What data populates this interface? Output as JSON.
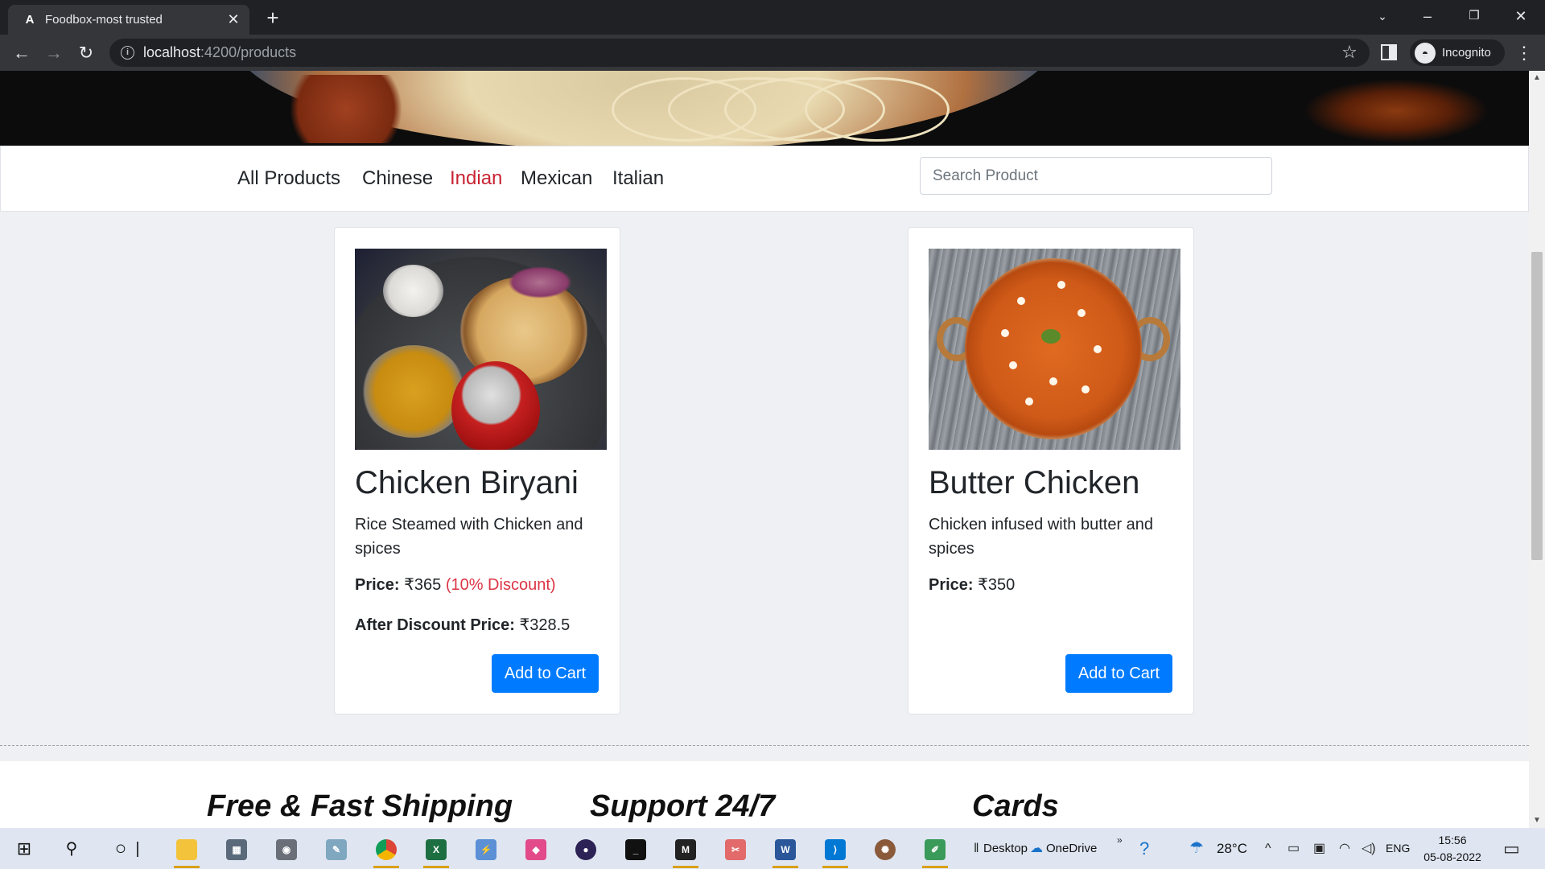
{
  "browser": {
    "tab_title": "Foodbox-most trusted",
    "tab_favicon": "A",
    "url_host": "localhost",
    "url_path": ":4200/products",
    "profile_label": "Incognito"
  },
  "category_nav": {
    "items": [
      {
        "label": "All Products",
        "active": false
      },
      {
        "label": "Chinese",
        "active": false
      },
      {
        "label": "Indian",
        "active": true
      },
      {
        "label": "Mexican",
        "active": false
      },
      {
        "label": "Italian",
        "active": false
      }
    ],
    "search_placeholder": "Search Product"
  },
  "products": [
    {
      "title": "Chicken Biryani",
      "description": "Rice Steamed with Chicken and spices",
      "price_label": "Price:",
      "price": "₹365",
      "discount": "(10% Discount)",
      "after_label": "After Discount Price:",
      "after_price": "₹328.5",
      "button": "Add to Cart"
    },
    {
      "title": "Butter Chicken",
      "description": "Chicken infused with butter and spices",
      "price_label": "Price:",
      "price": "₹350",
      "button": "Add to Cart"
    }
  ],
  "footer": {
    "features": [
      "Free & Fast Shipping",
      "Support 24/7",
      "Cards"
    ]
  },
  "taskbar": {
    "desktop_label": "Desktop",
    "onedrive_label": "OneDrive",
    "temperature": "28°C",
    "language": "ENG",
    "time": "15:56",
    "date": "05-08-2022"
  },
  "colors": {
    "accent_blue": "#007bff",
    "active_category": "#c82333",
    "discount_red": "#dc3545"
  }
}
